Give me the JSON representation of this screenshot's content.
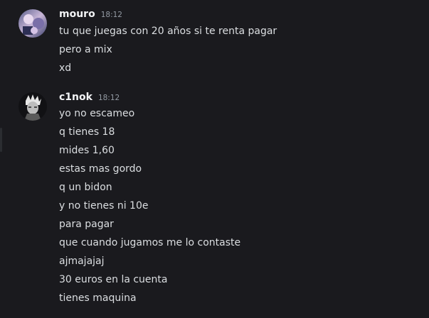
{
  "messages": [
    {
      "author": "mouro",
      "time": "18:12",
      "lines": [
        "tu que juegas con 20 años si te renta pagar",
        "pero a mix",
        "xd"
      ]
    },
    {
      "author": "c1nok",
      "time": "18:12",
      "lines": [
        "yo no escameo",
        "q tienes 18",
        "mides 1,60",
        "estas mas gordo",
        "q un bidon",
        "y no tienes ni 10e",
        "para pagar",
        "que cuando jugamos me lo contaste",
        "ajmajajaj",
        "30 euros en la cuenta",
        "tienes maquina"
      ]
    }
  ],
  "colors": {
    "background": "#1a1a1e",
    "username": "#f2f3f5",
    "text": "#dbdee1",
    "timestamp": "#949ba4"
  }
}
